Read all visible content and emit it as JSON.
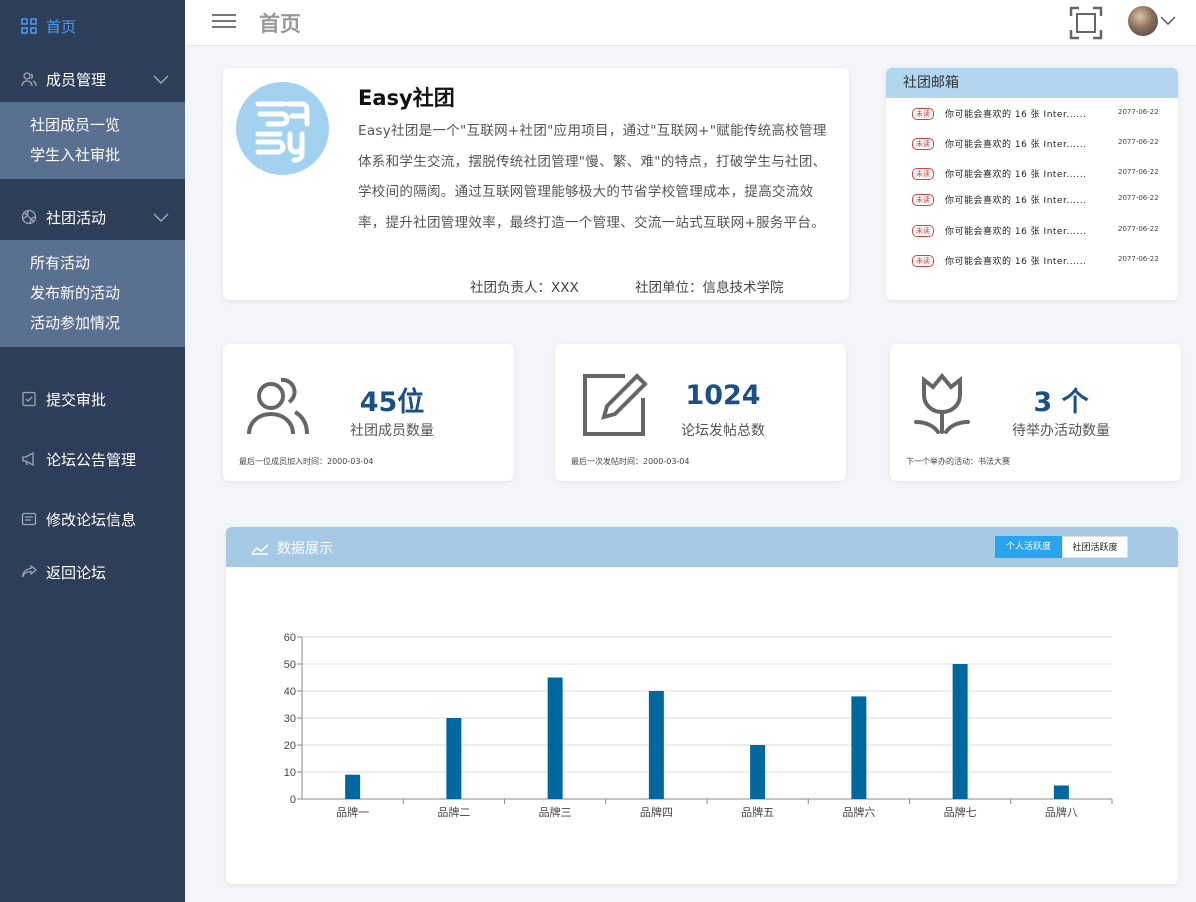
{
  "sidebar": {
    "home": "首页",
    "members_group": "成员管理",
    "members_items": [
      "社团成员一览",
      "学生入社审批"
    ],
    "activity_group": "社团活动",
    "activity_items": [
      "所有活动",
      "发布新的活动",
      "活动参加情况"
    ],
    "submit_approval": "提交审批",
    "forum_notice": "论坛公告管理",
    "edit_forum": "修改论坛信息",
    "back_forum": "返回论坛"
  },
  "header": {
    "title": "首页"
  },
  "intro": {
    "title": "Easy社团",
    "description": "Easy社团是一个\"互联网+社团\"应用项目，通过\"互联网+\"赋能传统高校管理体系和学生交流，摆脱传统社团管理\"慢、繁、难\"的特点，打破学生与社团、学校间的隔阂。通过互联网管理能够极大的节省学校管理成本，提高交流效率，提升社团管理效率，最终打造一个管理、交流一站式互联网+服务平台。",
    "leader": "社团负责人：XXX",
    "unit": "社团单位：信息技术学院"
  },
  "mailbox": {
    "title": "社团邮箱",
    "items": [
      {
        "badge": "未读",
        "text": "你可能会喜欢的 16 张 Inter......",
        "date": "2077-06-22"
      },
      {
        "badge": "未读",
        "text": "你可能会喜欢的 16 张 Inter......",
        "date": "2077-06-22"
      },
      {
        "badge": "未读",
        "text": "你可能会喜欢的 16 张 Inter......",
        "date": "2077-06-22"
      },
      {
        "badge": "未读",
        "text": "你可能会喜欢的 16 张 Inter......",
        "date": "2077-06-22"
      },
      {
        "badge": "未读",
        "text": "你可能会喜欢的 16 张 Inter......",
        "date": "2077-06-22"
      },
      {
        "badge": "未读",
        "text": "你可能会喜欢的 16 张 Inter......",
        "date": "2077-06-22"
      }
    ]
  },
  "stats": [
    {
      "value": "45位",
      "label": "社团成员数量",
      "foot": "最后一位成员加入时间：2000-03-04"
    },
    {
      "value": "1024",
      "label": "论坛发帖总数",
      "foot": "最后一次发帖时间：2000-03-04"
    },
    {
      "value": "3  个",
      "label": "待举办活动数量",
      "foot": "下一个举办的活动：书法大赛"
    }
  ],
  "chart_panel": {
    "title": "数据展示",
    "tab_personal": "个人活跃度",
    "tab_club": "社团活跃度"
  },
  "chart_data": {
    "type": "bar",
    "categories": [
      "品牌一",
      "品牌二",
      "品牌三",
      "品牌四",
      "品牌五",
      "品牌六",
      "品牌七",
      "品牌八"
    ],
    "values": [
      9,
      30,
      45,
      40,
      20,
      38,
      50,
      5
    ],
    "ylim": [
      0,
      60
    ],
    "yticks": [
      0,
      10,
      20,
      30,
      40,
      50,
      60
    ],
    "grid": true,
    "bar_color": "#00689e"
  },
  "colors": {
    "sidebar": "#2e3e58",
    "sidebar_sub": "#5a7090",
    "accent": "#4b9cf5",
    "stat_number": "#1c4f86"
  }
}
